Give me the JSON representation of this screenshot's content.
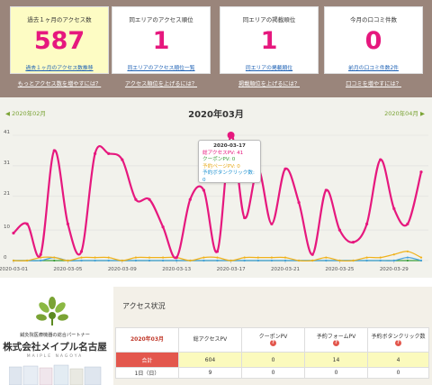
{
  "kpis": [
    {
      "title": "過去１ヶ月のアクセス数",
      "value": "587",
      "link": "過去１ヶ月のアクセス数推移",
      "howto": "もっとアクセス数を増やすには？"
    },
    {
      "title": "同エリアのアクセス順位",
      "value": "1",
      "link": "同エリアのアクセス順位一覧",
      "howto": "アクセス順位を上げるには？"
    },
    {
      "title": "同エリアの掲載順位",
      "value": "1",
      "link": "同エリアの掲載順位",
      "howto": "掲載順位を上げるには？"
    },
    {
      "title": "今月の口コミ件数",
      "value": "0",
      "link": "前月の口コミ件数2件",
      "howto": "口コミを増やすには？"
    }
  ],
  "chart_header": {
    "prev": "◀ 2020年02月",
    "title": "2020年03月",
    "next": "2020年04月 ▶"
  },
  "tooltip": {
    "date": "2020-03-17",
    "pv": "総アクセスPV: 41",
    "coupon": "クーポンPV: 0",
    "form": "予約ページPV: 0",
    "button": "予約ボタンクリック数: 0"
  },
  "colors": {
    "pv": "#e6187e",
    "coupon": "#3a9e3a",
    "form": "#f0b21b",
    "button": "#4aa3df",
    "accent": "#7aa334"
  },
  "chart_data": {
    "type": "line",
    "x": [
      "2020-03-01",
      "2020-03-02",
      "2020-03-03",
      "2020-03-04",
      "2020-03-05",
      "2020-03-06",
      "2020-03-07",
      "2020-03-08",
      "2020-03-09",
      "2020-03-10",
      "2020-03-11",
      "2020-03-12",
      "2020-03-13",
      "2020-03-14",
      "2020-03-15",
      "2020-03-16",
      "2020-03-17",
      "2020-03-18",
      "2020-03-19",
      "2020-03-20",
      "2020-03-21",
      "2020-03-22",
      "2020-03-23",
      "2020-03-24",
      "2020-03-25",
      "2020-03-26",
      "2020-03-27",
      "2020-03-28",
      "2020-03-29",
      "2020-03-30",
      "2020-03-31"
    ],
    "xticks": [
      "2020-03-01",
      "2020-03-05",
      "2020-03-09",
      "2020-03-13",
      "2020-03-17",
      "2020-03-21",
      "2020-03-25",
      "2020-03-29"
    ],
    "yticks": [
      0,
      10,
      21,
      31,
      41
    ],
    "ylim": [
      0,
      41
    ],
    "series": [
      {
        "key": "pv",
        "values": [
          9,
          12,
          2,
          36,
          12,
          3,
          35,
          35,
          33,
          20,
          20,
          11,
          1,
          20,
          23,
          3,
          41,
          14,
          30,
          12,
          30,
          19,
          2,
          23,
          10,
          6,
          12,
          33,
          17,
          12,
          29
        ]
      },
      {
        "key": "coupon",
        "values": [
          0,
          0,
          0,
          0,
          0,
          0,
          0,
          0,
          0,
          0,
          0,
          0,
          0,
          0,
          0,
          0,
          0,
          0,
          0,
          0,
          0,
          0,
          0,
          0,
          0,
          0,
          0,
          0,
          0,
          0,
          0
        ]
      },
      {
        "key": "form",
        "values": [
          0,
          0,
          1,
          1,
          0,
          1,
          1,
          1,
          0,
          1,
          1,
          1,
          1,
          0,
          1,
          1,
          0,
          1,
          1,
          1,
          1,
          0,
          0,
          1,
          0,
          0,
          1,
          1,
          2,
          3,
          1
        ]
      },
      {
        "key": "button",
        "values": [
          0,
          0,
          0,
          1,
          0,
          0,
          0,
          0,
          0,
          0,
          0,
          0,
          0,
          0,
          0,
          0,
          0,
          0,
          0,
          0,
          0,
          0,
          0,
          0,
          0,
          0,
          0,
          0,
          0,
          1,
          0
        ]
      }
    ]
  },
  "company": {
    "tagline": "鍼灸院医療機器の総合パートナー",
    "name": "株式会社メイプル名古屋",
    "roman": "MAIPLE NAGOYA"
  },
  "access": {
    "title": "アクセス状況",
    "month": "2020年03月",
    "headers": [
      "総アクセスPV",
      "クーポンPV",
      "予約フォームPV",
      "予約ボタンクリック数"
    ],
    "total_label": "合計",
    "total": [
      "604",
      "0",
      "14",
      "4"
    ],
    "row_label": "1日（日）",
    "row": [
      "9",
      "0",
      "0",
      "0"
    ]
  }
}
